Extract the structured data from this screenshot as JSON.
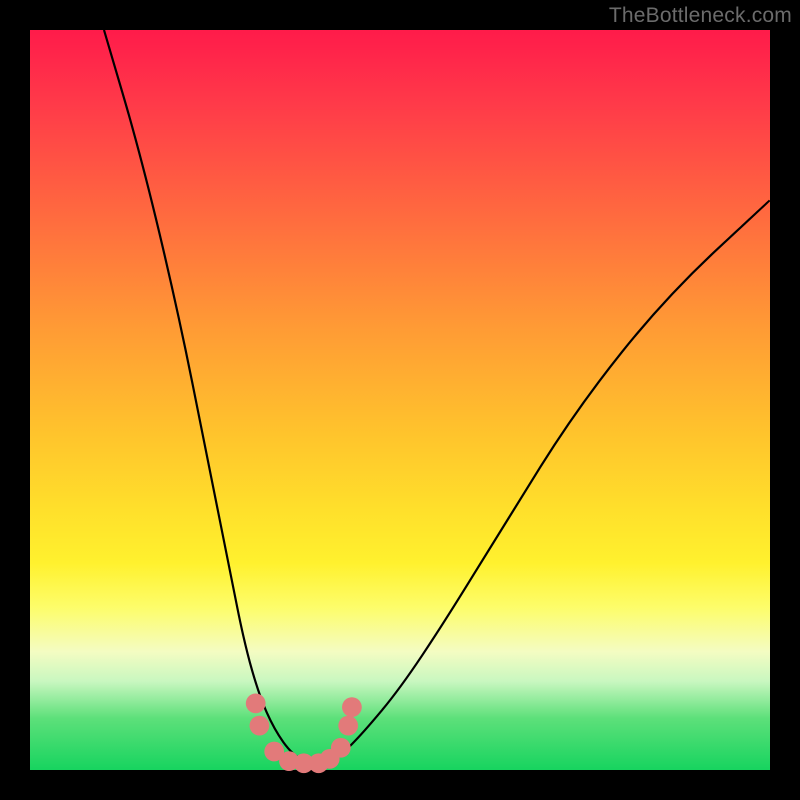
{
  "watermark": "TheBottleneck.com",
  "chart_data": {
    "type": "line",
    "title": "",
    "xlabel": "",
    "ylabel": "",
    "xlim": [
      0,
      100
    ],
    "ylim": [
      0,
      100
    ],
    "curve": {
      "name": "bottleneck-curve",
      "points_xy": [
        [
          10,
          100
        ],
        [
          15,
          83
        ],
        [
          20,
          62
        ],
        [
          24,
          42
        ],
        [
          27,
          27
        ],
        [
          29,
          17
        ],
        [
          31,
          10
        ],
        [
          33,
          5.5
        ],
        [
          35.5,
          2
        ],
        [
          38,
          0.8
        ],
        [
          40,
          0.8
        ],
        [
          42,
          2
        ],
        [
          45,
          5
        ],
        [
          50,
          11
        ],
        [
          56,
          20
        ],
        [
          64,
          33
        ],
        [
          74,
          49
        ],
        [
          86,
          64
        ],
        [
          100,
          77
        ]
      ]
    },
    "raw_points": {
      "name": "raw-data-cluster",
      "note": "pool of measured points near curve minimum",
      "r": 5.5,
      "points_xy": [
        [
          30.5,
          9.0
        ],
        [
          31.0,
          6.0
        ],
        [
          33.0,
          2.5
        ],
        [
          35.0,
          1.2
        ],
        [
          37.0,
          0.9
        ],
        [
          39.0,
          0.9
        ],
        [
          40.5,
          1.5
        ],
        [
          42.0,
          3.0
        ],
        [
          43.0,
          6.0
        ],
        [
          43.5,
          8.5
        ]
      ]
    },
    "gradient_stops": [
      {
        "pos": 0,
        "color": "#ff1b4a"
      },
      {
        "pos": 25,
        "color": "#ff6a3f"
      },
      {
        "pos": 55,
        "color": "#ffc52c"
      },
      {
        "pos": 78,
        "color": "#fdfd6a"
      },
      {
        "pos": 100,
        "color": "#17d45f"
      }
    ]
  }
}
